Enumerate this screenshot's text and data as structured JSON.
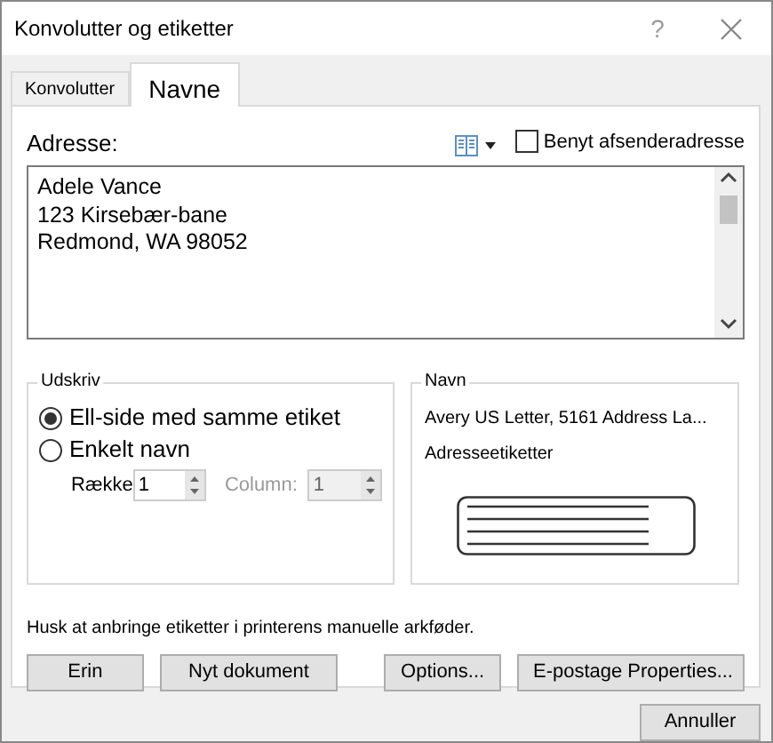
{
  "window": {
    "title": "Konvolutter og etiketter",
    "help": "?"
  },
  "tabs": [
    {
      "label": "Konvolutter",
      "selected": false
    },
    {
      "label": "Navne",
      "selected": true
    }
  ],
  "address": {
    "label": "Adresse:",
    "lines": [
      "Adele Vance",
      "123 Kirsebær-bane",
      "Redmond, WA 98052"
    ]
  },
  "use_sender": {
    "label": "Benyt afsenderadresse",
    "checked": false
  },
  "print": {
    "title": "Udskriv",
    "options": [
      {
        "label": "Ell-side med samme etiket",
        "selected": true
      },
      {
        "label": "Enkelt navn",
        "selected": false
      }
    ],
    "spinners": [
      {
        "label": "Række",
        "value": "1",
        "disabled": false
      },
      {
        "label": "Column:",
        "value": "1",
        "disabled": true
      }
    ]
  },
  "label": {
    "title": "Navn",
    "product": "Avery US Letter, 5161 Address La...",
    "type": "Adresseetiketter"
  },
  "note": "Husk at anbringe etiketter i printerens manuelle arkføder.",
  "buttons": [
    "Erin",
    "Nyt dokument",
    "Options...",
    "E-postage Properties..."
  ],
  "cancel": "Annuller"
}
